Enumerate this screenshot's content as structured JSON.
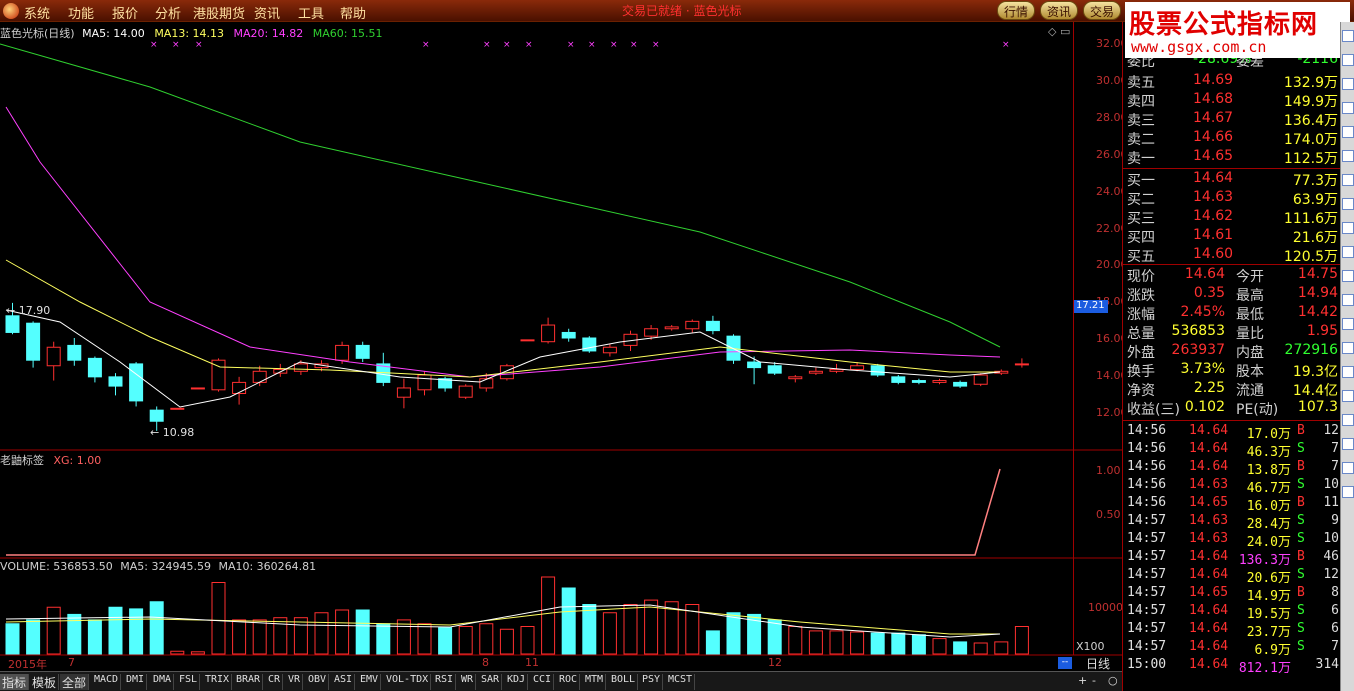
{
  "menu": [
    "系统",
    "功能",
    "报价",
    "分析",
    "港股期货",
    "资讯",
    "工具",
    "帮助"
  ],
  "title_center": "交易已就绪 · 蓝色光标",
  "top_buttons": [
    "行情",
    "资讯",
    "交易"
  ],
  "logo": {
    "main": "股票公式指标网",
    "url": "www.gsgx.com.cn"
  },
  "main_header": {
    "name": "蓝色光标(日线)",
    "ma5": "MA5: 14.00",
    "ma13": "MA13: 14.13",
    "ma20": "MA20: 14.82",
    "ma60": "MA60: 15.51"
  },
  "price_axis": [
    "32.00",
    "30.00",
    "28.00",
    "26.00",
    "24.00",
    "22.00",
    "20.00",
    "18.00",
    "16.00",
    "14.00",
    "12.00"
  ],
  "current_flag": "17.21",
  "annotations": {
    "high": "17.90",
    "low": "10.98"
  },
  "ind_header": {
    "name": "老鼬标签",
    "value": "XG: 1.00"
  },
  "ind_axis": [
    "1.00",
    "0.50"
  ],
  "vol_header": {
    "vol": "VOLUME: 536853.50",
    "ma5": "MA5: 324945.59",
    "ma10": "MA10: 360264.81"
  },
  "vol_axis": {
    "tick": "10000",
    "unit": "X100"
  },
  "dates": [
    {
      "label": "2015年",
      "pos": 8
    },
    {
      "label": "7",
      "pos": 68
    },
    {
      "label": "8",
      "pos": 482
    },
    {
      "label": "11",
      "pos": 525
    },
    {
      "label": "12",
      "pos": 768
    }
  ],
  "period": "日线",
  "tabs": [
    "指标",
    "模板",
    "全部",
    "MACD",
    "DMI",
    "DMA",
    "FSL",
    "TRIX",
    "BRAR",
    "CR",
    "VR",
    "OBV",
    "ASI",
    "EMV",
    "VOL-TDX",
    "RSI",
    "WR",
    "SAR",
    "KDJ",
    "CCI",
    "ROC",
    "MTM",
    "BOLL",
    "PSY",
    "MCST"
  ],
  "panel": {
    "weibi": {
      "label": "委比",
      "value": "-28.69%",
      "label2": "委差",
      "value2": "-2116"
    },
    "sell": [
      {
        "label": "卖五",
        "price": "14.69",
        "vol": "132.9万"
      },
      {
        "label": "卖四",
        "price": "14.68",
        "vol": "149.9万"
      },
      {
        "label": "卖三",
        "price": "14.67",
        "vol": "136.4万"
      },
      {
        "label": "卖二",
        "price": "14.66",
        "vol": "174.0万"
      },
      {
        "label": "卖一",
        "price": "14.65",
        "vol": "112.5万"
      }
    ],
    "buy": [
      {
        "label": "买一",
        "price": "14.64",
        "vol": "77.3万"
      },
      {
        "label": "买二",
        "price": "14.63",
        "vol": "63.9万"
      },
      {
        "label": "买三",
        "price": "14.62",
        "vol": "111.6万"
      },
      {
        "label": "买四",
        "price": "14.61",
        "vol": "21.6万"
      },
      {
        "label": "买五",
        "price": "14.60",
        "vol": "120.5万"
      }
    ],
    "stats": [
      {
        "l1": "现价",
        "v1": "14.64",
        "c1": "#ff3030",
        "l2": "今开",
        "v2": "14.75",
        "c2": "#ff3030"
      },
      {
        "l1": "涨跌",
        "v1": "0.35",
        "c1": "#ff3030",
        "l2": "最高",
        "v2": "14.94",
        "c2": "#ff3030"
      },
      {
        "l1": "涨幅",
        "v1": "2.45%",
        "c1": "#ff3030",
        "l2": "最低",
        "v2": "14.42",
        "c2": "#ff3030"
      },
      {
        "l1": "总量",
        "v1": "536853",
        "c1": "#ffff30",
        "l2": "量比",
        "v2": "1.95",
        "c2": "#ff3030"
      },
      {
        "l1": "外盘",
        "v1": "263937",
        "c1": "#ff3030",
        "l2": "内盘",
        "v2": "272916",
        "c2": "#30ff30"
      },
      {
        "l1": "换手",
        "v1": "3.73%",
        "c1": "#ffff30",
        "l2": "股本",
        "v2": "19.3亿",
        "c2": "#ffff30"
      },
      {
        "l1": "净资",
        "v1": "2.25",
        "c1": "#ffff30",
        "l2": "流通",
        "v2": "14.4亿",
        "c2": "#ffff30"
      },
      {
        "l1": "收益(三)",
        "v1": "0.102",
        "c1": "#ffff30",
        "l2": "PE(动)",
        "v2": "107.3",
        "c2": "#ffff30"
      }
    ],
    "ticks": [
      {
        "t": "14:56",
        "p": "14.64",
        "v": "17.0万",
        "bs": "B",
        "n": "12"
      },
      {
        "t": "14:56",
        "p": "14.64",
        "v": "46.3万",
        "bs": "S",
        "n": "7"
      },
      {
        "t": "14:56",
        "p": "14.64",
        "v": "13.8万",
        "bs": "B",
        "n": "7"
      },
      {
        "t": "14:56",
        "p": "14.63",
        "v": "46.7万",
        "bs": "S",
        "n": "10"
      },
      {
        "t": "14:56",
        "p": "14.65",
        "v": "16.0万",
        "bs": "B",
        "n": "11"
      },
      {
        "t": "14:57",
        "p": "14.63",
        "v": "28.4万",
        "bs": "S",
        "n": "9"
      },
      {
        "t": "14:57",
        "p": "14.63",
        "v": "24.0万",
        "bs": "S",
        "n": "10"
      },
      {
        "t": "14:57",
        "p": "14.64",
        "v": "136.3万",
        "bs": "B",
        "n": "46"
      },
      {
        "t": "14:57",
        "p": "14.64",
        "v": "20.6万",
        "bs": "S",
        "n": "12"
      },
      {
        "t": "14:57",
        "p": "14.65",
        "v": "14.9万",
        "bs": "B",
        "n": "8"
      },
      {
        "t": "14:57",
        "p": "14.64",
        "v": "19.5万",
        "bs": "S",
        "n": "6"
      },
      {
        "t": "14:57",
        "p": "14.64",
        "v": "23.7万",
        "bs": "S",
        "n": "6"
      },
      {
        "t": "14:57",
        "p": "14.64",
        "v": "6.9万",
        "bs": "S",
        "n": "7"
      },
      {
        "t": "15:00",
        "p": "14.64",
        "v": "812.1万",
        "bs": "",
        "n": "314"
      }
    ]
  },
  "sidebar_icons": 20,
  "colors": {
    "up": "#ff3030",
    "down": "#54ffff",
    "ma5": "#ffffff",
    "ma13": "#ffff60",
    "ma20": "#ff40ff",
    "ma60": "#30d030"
  }
}
